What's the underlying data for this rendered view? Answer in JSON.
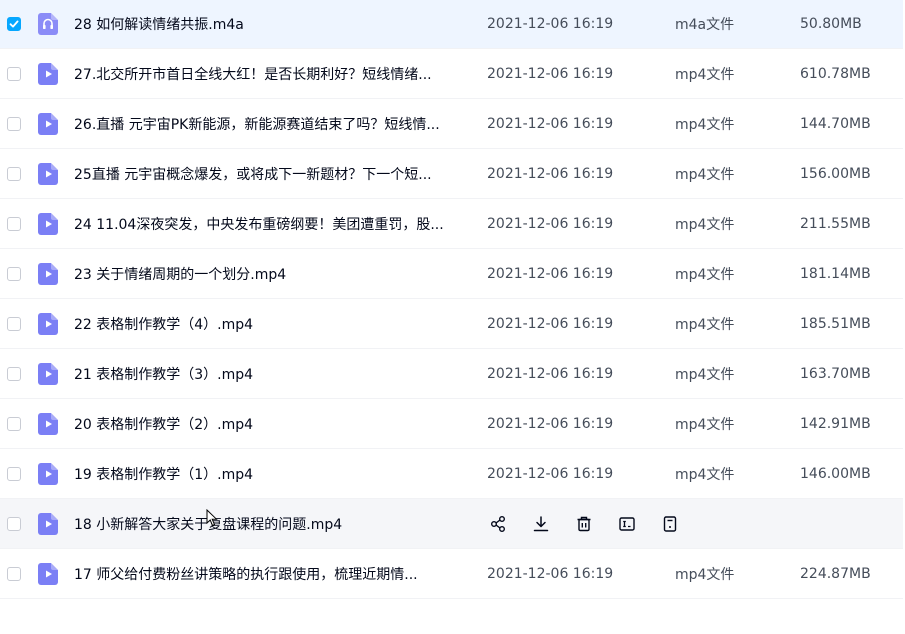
{
  "files": [
    {
      "name": "28 如何解读情绪共振.m4a",
      "date": "2021-12-06 16:19",
      "type": "m4a文件",
      "size": "50.80MB",
      "kind": "audio",
      "selected": true
    },
    {
      "name": "27.北交所开市首日全线大红！是否长期利好？短线情绪...",
      "date": "2021-12-06 16:19",
      "type": "mp4文件",
      "size": "610.78MB",
      "kind": "video"
    },
    {
      "name": "26.直播 元宇宙PK新能源，新能源赛道结束了吗？短线情...",
      "date": "2021-12-06 16:19",
      "type": "mp4文件",
      "size": "144.70MB",
      "kind": "video"
    },
    {
      "name": "25直播 元宇宙概念爆发，或将成下一新题材？下一个短...",
      "date": "2021-12-06 16:19",
      "type": "mp4文件",
      "size": "156.00MB",
      "kind": "video"
    },
    {
      "name": "24 11.04深夜突发，中央发布重磅纲要！美团遭重罚，股...",
      "date": "2021-12-06 16:19",
      "type": "mp4文件",
      "size": "211.55MB",
      "kind": "video"
    },
    {
      "name": "23 关于情绪周期的一个划分.mp4",
      "date": "2021-12-06 16:19",
      "type": "mp4文件",
      "size": "181.14MB",
      "kind": "video"
    },
    {
      "name": "22 表格制作教学（4）.mp4",
      "date": "2021-12-06 16:19",
      "type": "mp4文件",
      "size": "185.51MB",
      "kind": "video"
    },
    {
      "name": "21 表格制作教学（3）.mp4",
      "date": "2021-12-06 16:19",
      "type": "mp4文件",
      "size": "163.70MB",
      "kind": "video"
    },
    {
      "name": "20 表格制作教学（2）.mp4",
      "date": "2021-12-06 16:19",
      "type": "mp4文件",
      "size": "142.91MB",
      "kind": "video"
    },
    {
      "name": "19 表格制作教学（1）.mp4",
      "date": "2021-12-06 16:19",
      "type": "mp4文件",
      "size": "146.00MB",
      "kind": "video"
    },
    {
      "name": "18 小新解答大家关于复盘课程的问题.mp4",
      "date": "",
      "type": "",
      "size": "",
      "kind": "video",
      "hovered": true
    },
    {
      "name": "17 师父给付费粉丝讲策略的执行跟使用，梳理近期情...",
      "date": "2021-12-06 16:19",
      "type": "mp4文件",
      "size": "224.87MB",
      "kind": "video"
    }
  ],
  "hover_actions": [
    {
      "icon": "share-icon"
    },
    {
      "icon": "download-icon"
    },
    {
      "icon": "delete-icon"
    },
    {
      "icon": "rename-icon"
    },
    {
      "icon": "more-icon"
    }
  ],
  "colors": {
    "accent": "#06a7ff",
    "video_icon": "#7b7ff5",
    "audio_icon": "#8b8cf7",
    "selected_row": "#eef5ff",
    "hover_row": "#f5f6f9"
  }
}
